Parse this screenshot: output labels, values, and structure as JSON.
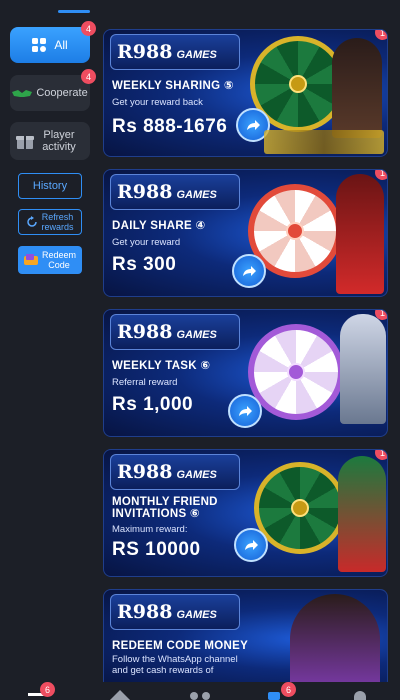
{
  "sidebar": {
    "all_label": "All",
    "all_badge": "4",
    "cooperate_label": "Cooperate",
    "cooperate_badge": "4",
    "player_activity_line1": "Player",
    "player_activity_line2": "activity",
    "history_label": "History",
    "refresh_line1": "Refresh",
    "refresh_line2": "rewards",
    "redeem_line1": "Redeem",
    "redeem_line2": "Code"
  },
  "cards": [
    {
      "logo_main": "R988",
      "logo_sub": "GAMES",
      "badge": "1",
      "title": "WEEKLY SHARING ⑤",
      "subtitle": "Get your reward back",
      "amount": "Rs 888-1676",
      "accent": "#d8b32a"
    },
    {
      "logo_main": "R988",
      "logo_sub": "GAMES",
      "badge": "1",
      "title": "DAILY SHARE ④",
      "subtitle": "Get your reward",
      "amount": "Rs 300",
      "accent": "#e24a3a"
    },
    {
      "logo_main": "R988",
      "logo_sub": "GAMES",
      "badge": "1",
      "title": "WEEKLY TASK ⑥",
      "subtitle": "Referral reward",
      "amount": "Rs 1,000",
      "accent": "#a35ad8"
    },
    {
      "logo_main": "R988",
      "logo_sub": "GAMES",
      "badge": "1",
      "title": "MONTHLY FRIEND INVITATIONS ⑥",
      "subtitle": "Maximum reward:",
      "amount": "RS 10000",
      "accent": "#2ea44a"
    },
    {
      "logo_main": "R988",
      "logo_sub": "GAMES",
      "title": "REDEEM CODE MONEY",
      "subtitle": "Follow the WhatsApp channel and get cash rewards of",
      "accent": "#d8b32a"
    }
  ],
  "bottom_nav": {
    "badge_left": "6",
    "badge_right": "6"
  },
  "colors": {
    "accent": "#2f8ef5",
    "badge": "#ee4d60",
    "background": "#1c1f27"
  }
}
